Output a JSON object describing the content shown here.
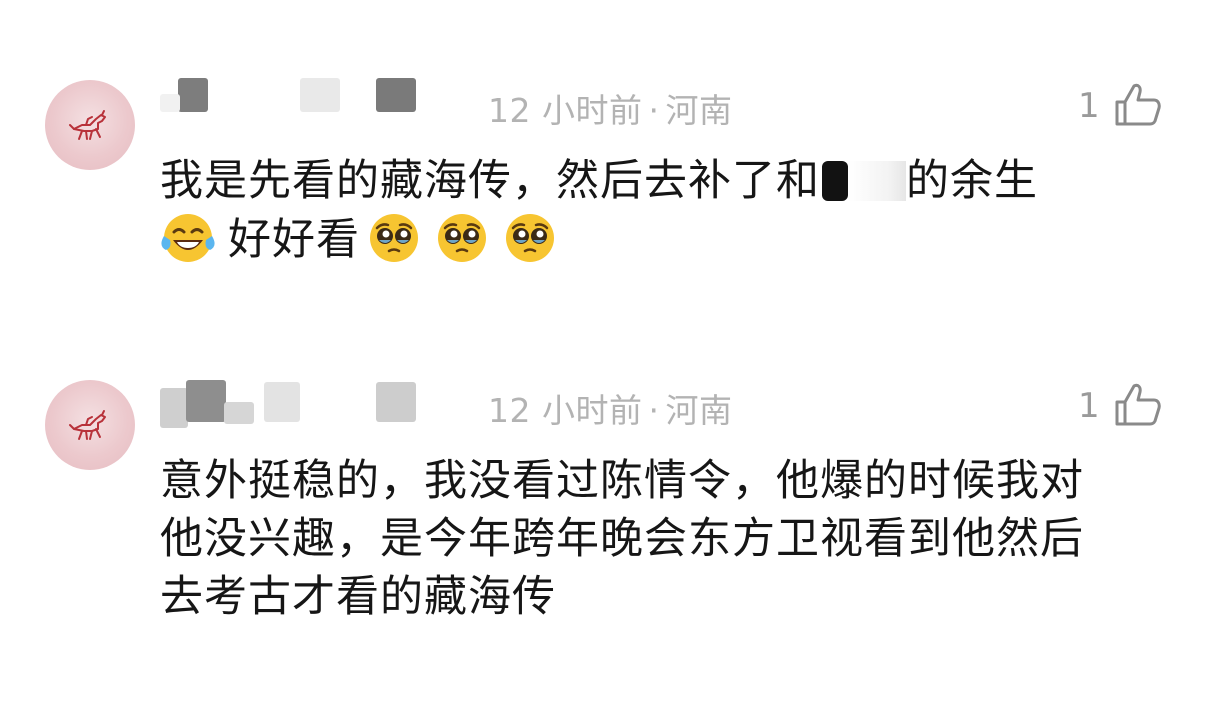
{
  "comments": [
    {
      "time": "12 小时前",
      "separator": "·",
      "location": "河南",
      "likes": "1",
      "text_part1": "我是先看的藏海传，然后去补了和",
      "text_part2": "的余生",
      "text_line2": "好好看",
      "emoji_line2": [
        "face-with-tears-of-joy",
        "pleading-face",
        "pleading-face",
        "pleading-face"
      ]
    },
    {
      "time": "12 小时前",
      "separator": "·",
      "location": "河南",
      "likes": "1",
      "text_line1": "意外挺稳的，我没看过陈情令，他爆的时候我对",
      "text_line2": "他没兴趣，是今年跨年晚会东方卫视看到他然后",
      "text_line3": "去考古才看的藏海传"
    }
  ],
  "colors": {
    "meta_text": "#b3b3b3",
    "body_text": "#161616",
    "like_text": "#9a9a9a",
    "avatar_bg": "#ecc9cd",
    "avatar_mark": "#b8323a"
  }
}
